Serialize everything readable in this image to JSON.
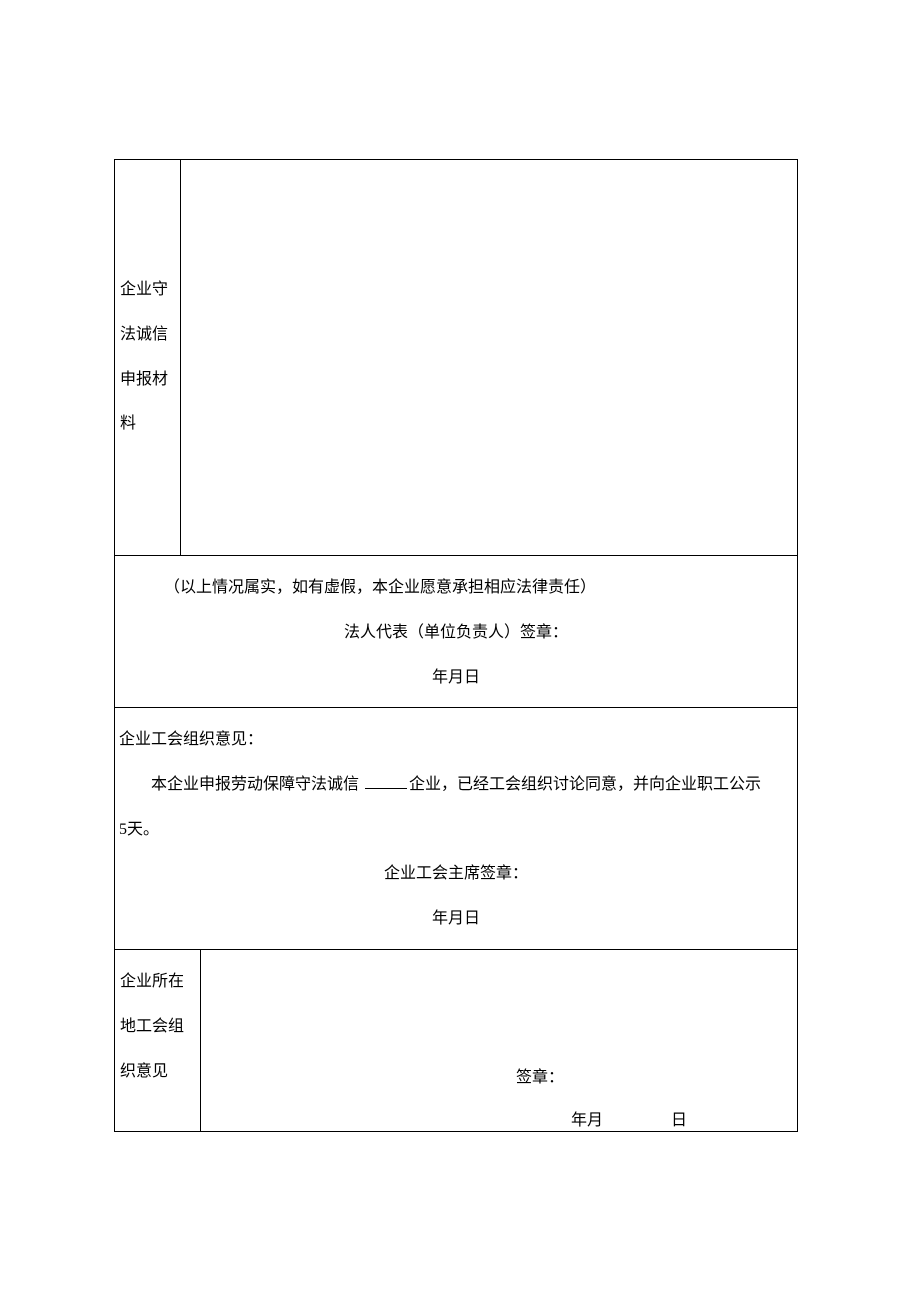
{
  "section1": {
    "label": "企业守法诚信申报材料"
  },
  "section2": {
    "disclaimer": "（以上情况属实，如有虚假，本企业愿意承担相应法律责任）",
    "signature_label": "法人代表（单位负责人）签章：",
    "date_label": "年月日"
  },
  "section3": {
    "title": "企业工会组织意见：",
    "body_prefix": "本企业申报劳动保障守法诚信 ",
    "body_suffix": "企业，已经工会组织讨论同意，并向企业职工公示",
    "body_line2": "5天。",
    "signature_label": "企业工会主席签章：",
    "date_label": "年月日"
  },
  "section4": {
    "label": "企业所在地工会组织意见",
    "signature_label": "签章：",
    "date_ym": "年月",
    "date_d": "日"
  }
}
